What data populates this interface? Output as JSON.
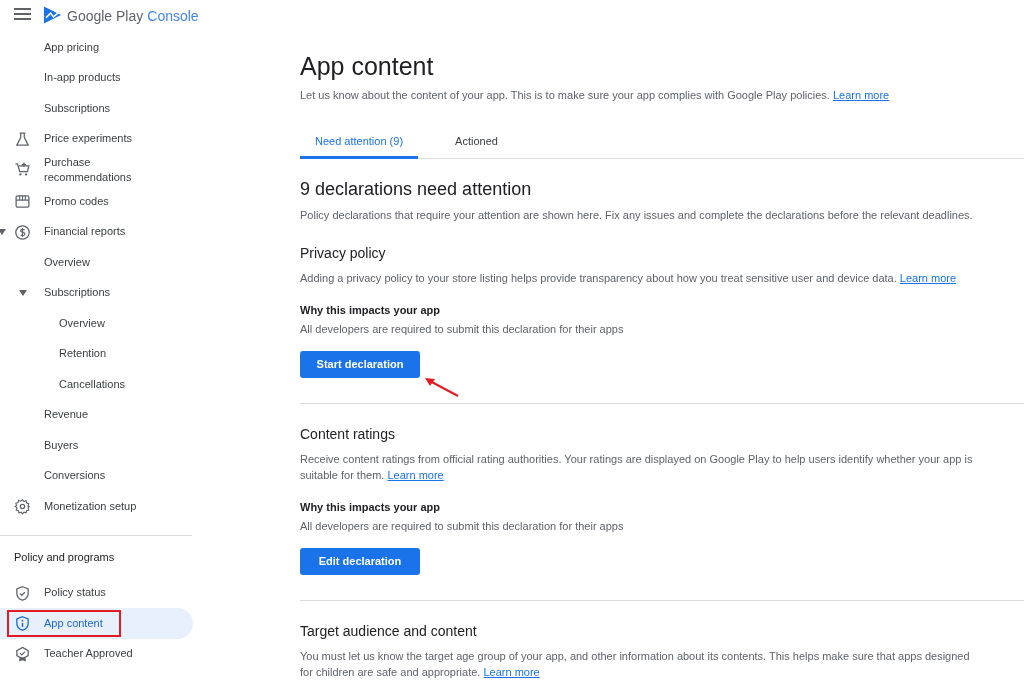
{
  "header": {
    "brand": "Google Play",
    "product": "Console"
  },
  "sidebar": {
    "items": [
      {
        "label": "App pricing"
      },
      {
        "label": "In-app products"
      },
      {
        "label": "Subscriptions"
      },
      {
        "label": "Price experiments"
      },
      {
        "label": "Purchase recommendations"
      },
      {
        "label": "Promo codes"
      },
      {
        "label": "Financial reports",
        "expanded": true,
        "children": [
          {
            "label": "Overview"
          },
          {
            "label": "Subscriptions",
            "expanded": true,
            "children": [
              {
                "label": "Overview"
              },
              {
                "label": "Retention"
              },
              {
                "label": "Cancellations"
              }
            ]
          },
          {
            "label": "Revenue"
          },
          {
            "label": "Buyers"
          },
          {
            "label": "Conversions"
          }
        ]
      },
      {
        "label": "Monetization setup"
      }
    ],
    "section_title": "Policy and programs",
    "policy_items": [
      {
        "label": "Policy status",
        "selected": false,
        "highlighted": false
      },
      {
        "label": "App content",
        "selected": true,
        "highlighted": true
      },
      {
        "label": "Teacher Approved",
        "selected": false,
        "highlighted": false
      }
    ]
  },
  "page": {
    "title": "App content",
    "subtitle": {
      "text": "Let us know about the content of your app. This is to make sure your app complies with Google Play policies.",
      "link": "Learn more"
    },
    "tabs": [
      {
        "label": "Need attention (9)",
        "selected": true
      },
      {
        "label": "Actioned",
        "selected": false
      }
    ],
    "heading": "9 declarations need attention",
    "intro": "Policy declarations that require your attention are shown here. Fix any issues and complete the declarations before the relevant deadlines.",
    "sections": [
      {
        "title": "Privacy policy",
        "description": {
          "text": "Adding a privacy policy to your store listing helps provide transparency about how you treat sensitive user and device data.",
          "link": "Learn more"
        },
        "why_title": "Why this impacts your app",
        "why_text": "All developers are required to submit this declaration for their apps",
        "button": "Start declaration",
        "annotated": true
      },
      {
        "title": "Content ratings",
        "description": {
          "text": "Receive content ratings from official rating authorities. Your ratings are displayed on Google Play to help users identify whether your app is suitable for them.",
          "link": "Learn more"
        },
        "why_title": "Why this impacts your app",
        "why_text": "All developers are required to submit this declaration for their apps",
        "button": "Edit declaration",
        "annotated": false
      },
      {
        "title": "Target audience and content",
        "description": {
          "text": "You must let us know the target age group of your app, and other information about its contents. This helps make sure that apps designed for children are safe and appropriate.",
          "link": "Learn more"
        }
      }
    ]
  }
}
